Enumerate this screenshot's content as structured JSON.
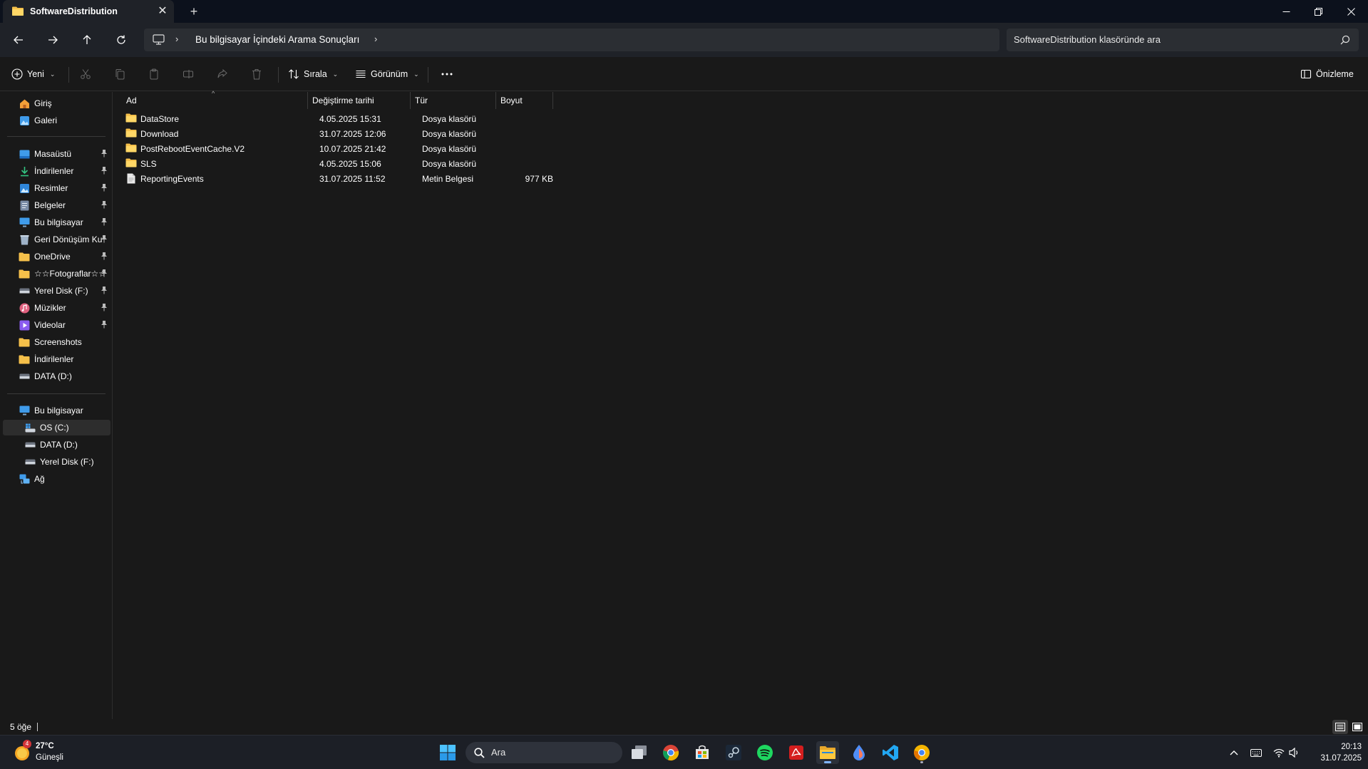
{
  "window": {
    "tab_title": "SoftwareDistribution",
    "new_tab": "+"
  },
  "address": {
    "breadcrumb": "Bu bilgisayar İçindeki Arama Sonuçları",
    "search_placeholder": "SoftwareDistribution klasöründe ara"
  },
  "toolbar": {
    "new_label": "Yeni",
    "sort_label": "Sırala",
    "view_label": "Görünüm",
    "preview_label": "Önizleme"
  },
  "sidebar": {
    "top": [
      {
        "label": "Giriş",
        "icon": "home-icon"
      },
      {
        "label": "Galeri",
        "icon": "gallery-icon"
      }
    ],
    "pinned": [
      {
        "label": "Masaüstü",
        "icon": "desktop-icon",
        "pinned": true
      },
      {
        "label": "İndirilenler",
        "icon": "download-icon",
        "pinned": true
      },
      {
        "label": "Resimler",
        "icon": "pictures-icon",
        "pinned": true
      },
      {
        "label": "Belgeler",
        "icon": "documents-icon",
        "pinned": true
      },
      {
        "label": "Bu bilgisayar",
        "icon": "computer-icon",
        "pinned": true
      },
      {
        "label": "Geri Dönüşüm Ku",
        "icon": "recycle-bin-icon",
        "pinned": true
      },
      {
        "label": "OneDrive",
        "icon": "folder-icon",
        "pinned": true
      },
      {
        "label": "☆☆Fotograflar☆☆",
        "icon": "folder-icon",
        "pinned": true
      },
      {
        "label": "Yerel Disk (F:)",
        "icon": "drive-icon",
        "pinned": true
      },
      {
        "label": "Müzikler",
        "icon": "music-icon",
        "pinned": true
      },
      {
        "label": "Videolar",
        "icon": "videos-icon",
        "pinned": true
      },
      {
        "label": "Screenshots",
        "icon": "folder-icon",
        "pinned": false
      },
      {
        "label": "İndirilenler",
        "icon": "folder-icon",
        "pinned": false
      },
      {
        "label": "DATA (D:)",
        "icon": "drive-icon",
        "pinned": false
      }
    ],
    "this_pc": {
      "label": "Bu bilgisayar",
      "icon": "computer-icon"
    },
    "drives": [
      {
        "label": "OS (C:)",
        "icon": "windows-drive-icon",
        "selected": true
      },
      {
        "label": "DATA (D:)",
        "icon": "drive-icon",
        "selected": false
      },
      {
        "label": "Yerel Disk (F:)",
        "icon": "drive-icon",
        "selected": false
      }
    ],
    "network": {
      "label": "Ağ",
      "icon": "network-icon"
    }
  },
  "columns": {
    "name": "Ad",
    "modified": "Değiştirme tarihi",
    "type": "Tür",
    "size": "Boyut"
  },
  "files": [
    {
      "name": "DataStore",
      "modified": "4.05.2025 15:31",
      "type": "Dosya klasörü",
      "size": "",
      "kind": "folder"
    },
    {
      "name": "Download",
      "modified": "31.07.2025 12:06",
      "type": "Dosya klasörü",
      "size": "",
      "kind": "folder"
    },
    {
      "name": "PostRebootEventCache.V2",
      "modified": "10.07.2025 21:42",
      "type": "Dosya klasörü",
      "size": "",
      "kind": "folder"
    },
    {
      "name": "SLS",
      "modified": "4.05.2025 15:06",
      "type": "Dosya klasörü",
      "size": "",
      "kind": "folder"
    },
    {
      "name": "ReportingEvents",
      "modified": "31.07.2025 11:52",
      "type": "Metin Belgesi",
      "size": "977 KB",
      "kind": "text"
    }
  ],
  "status": {
    "item_count": "5 öğe"
  },
  "taskbar": {
    "weather_temp": "27°C",
    "weather_condition": "Güneşli",
    "weather_badge": "4",
    "search_label": "Ara",
    "apps": [
      "windows-start-icon",
      "task-view-icon",
      "chrome-icon",
      "microsoft-store-icon",
      "steam-icon",
      "spotify-icon",
      "acrobat-icon",
      "file-explorer-icon",
      "paint-drop-icon",
      "vscode-icon",
      "chrome-canary-icon"
    ],
    "time": "20:13",
    "date": "31.07.2025"
  },
  "colors": {
    "window_bg": "#191919",
    "chrome_bg": "#1f2228",
    "title_bg": "#0c111c",
    "folder_yellow": "#f5c04a",
    "accent": "#4aa3f0"
  }
}
